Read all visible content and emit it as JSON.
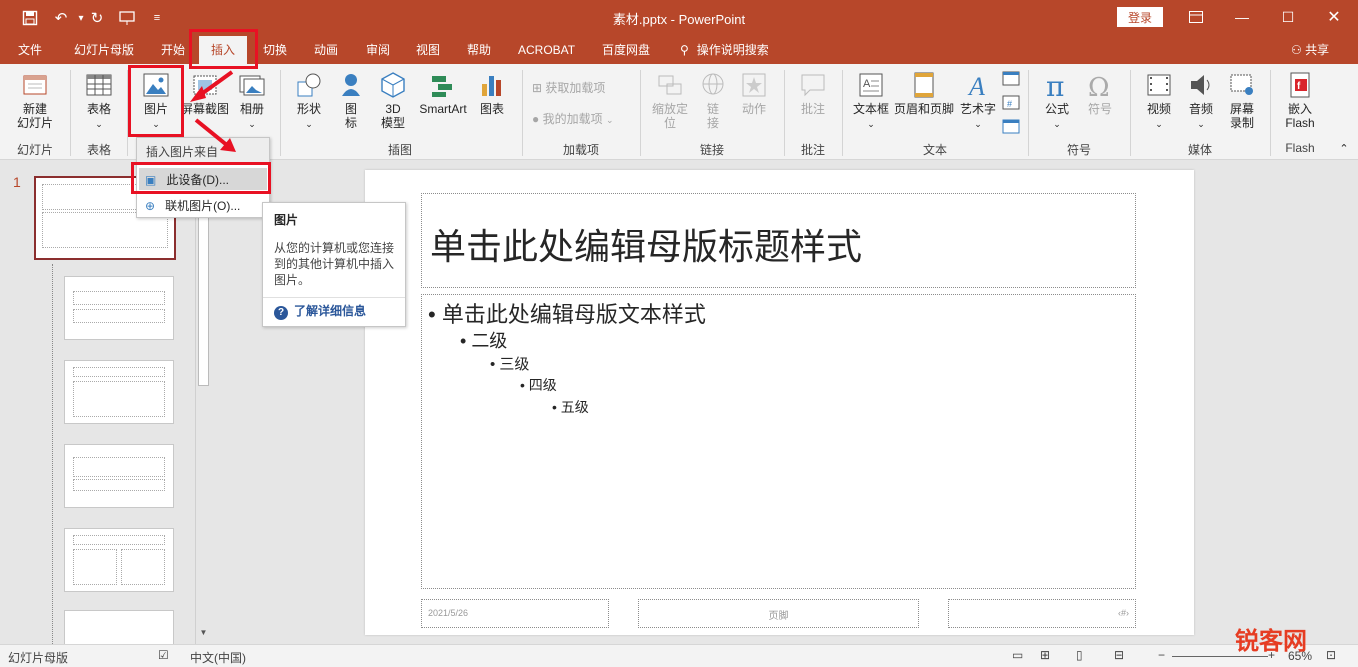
{
  "window": {
    "title": "素材.pptx - PowerPoint",
    "login_label": "登录"
  },
  "tabs": [
    "文件",
    "幻灯片母版",
    "开始",
    "插入",
    "切换",
    "动画",
    "审阅",
    "视图",
    "帮助",
    "ACROBAT",
    "百度网盘"
  ],
  "tell_me": "操作说明搜索",
  "share": "共享",
  "ribbon": {
    "new_slide": "新建\n幻灯片",
    "table": "表格",
    "picture": "图片",
    "screenshot": "屏幕截图",
    "album": "相册",
    "shapes": "形状",
    "icons": "图\n标",
    "model3d": "3D\n模型",
    "smartart": "SmartArt",
    "chart": "图表",
    "get_addins": "获取加载项",
    "my_addins": "我的加载项",
    "zoom": "缩放定\n位",
    "link": "链\n接",
    "action": "动作",
    "comment": "批注",
    "textbox": "文本框",
    "header_footer": "页眉和页脚",
    "wordart": "艺术字",
    "equation": "公式",
    "symbol": "符号",
    "video": "视频",
    "audio": "音频",
    "screen_rec": "屏幕\n录制",
    "embed_flash": "嵌入\nFlash",
    "groups": {
      "slides": "幻灯片",
      "tables": "表格",
      "images": "插图",
      "addins": "加载项",
      "links": "链接",
      "comments": "批注",
      "text": "文本",
      "symbols": "符号",
      "media": "媒体",
      "flash": "Flash"
    }
  },
  "picture_menu": {
    "header": "插入图片来自",
    "this_device": "此设备(D)...",
    "online": "联机图片(O)..."
  },
  "tooltip": {
    "title": "图片",
    "body": "从您的计算机或您连接到的其他计算机中插入图片。",
    "link": "了解详细信息"
  },
  "thumbs": {
    "first_number": "1"
  },
  "slide": {
    "title": "单击此处编辑母版标题样式",
    "body_level1": "单击此处编辑母版文本样式",
    "level2": "二级",
    "level3": "三级",
    "level4": "四级",
    "level5": "五级",
    "date": "2021/5/26",
    "footer": "页脚",
    "page_num": "‹#›"
  },
  "status": {
    "view": "幻灯片母版",
    "language": "中文(中国)",
    "zoom": "65%"
  },
  "watermark": "锐客网",
  "colors": {
    "accent": "#b7472a",
    "highlight": "#e81123"
  }
}
